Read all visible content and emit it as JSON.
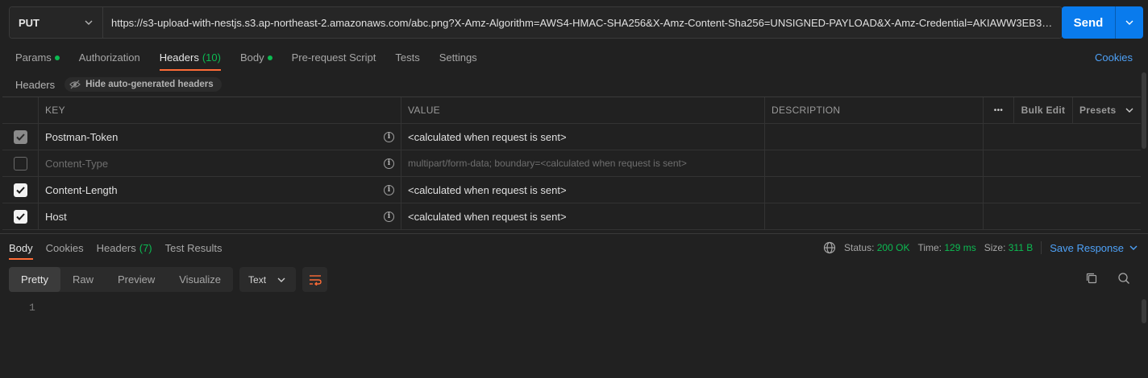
{
  "request": {
    "method": "PUT",
    "url": "https://s3-upload-with-nestjs.s3.ap-northeast-2.amazonaws.com/abc.png?X-Amz-Algorithm=AWS4-HMAC-SHA256&X-Amz-Content-Sha256=UNSIGNED-PAYLOAD&X-Amz-Credential=AKIAWW3EB3Y6...",
    "send_label": "Send"
  },
  "req_tabs": {
    "params": "Params",
    "authorization": "Authorization",
    "headers": "Headers",
    "headers_count": "(10)",
    "body": "Body",
    "prerequest": "Pre-request Script",
    "tests": "Tests",
    "settings": "Settings",
    "cookies": "Cookies"
  },
  "headers_section": {
    "title": "Headers",
    "hide_auto": "Hide auto-generated headers"
  },
  "table": {
    "columns": {
      "key": "KEY",
      "value": "VALUE",
      "description": "DESCRIPTION",
      "more": "•••",
      "bulk_edit": "Bulk Edit",
      "presets": "Presets"
    },
    "rows": [
      {
        "checked": "dim",
        "key": "Postman-Token",
        "value": "<calculated when request is sent>",
        "muted": false
      },
      {
        "checked": "off",
        "key": "Content-Type",
        "value": "multipart/form-data; boundary=<calculated when request is sent>",
        "muted": true
      },
      {
        "checked": "on",
        "key": "Content-Length",
        "value": "<calculated when request is sent>",
        "muted": false
      },
      {
        "checked": "on",
        "key": "Host",
        "value": "<calculated when request is sent>",
        "muted": false
      }
    ]
  },
  "response": {
    "tabs": {
      "body": "Body",
      "cookies": "Cookies",
      "headers": "Headers",
      "headers_count": "(7)",
      "test_results": "Test Results"
    },
    "status_label": "Status:",
    "status_value": "200 OK",
    "time_label": "Time:",
    "time_value": "129 ms",
    "size_label": "Size:",
    "size_value": "311 B",
    "save_response": "Save Response",
    "formats": [
      "Pretty",
      "Raw",
      "Preview",
      "Visualize"
    ],
    "text_type": "Text",
    "line_number": "1"
  },
  "colors": {
    "accent": "#ff6c37",
    "send": "#097bed",
    "green": "#0cbb52",
    "link": "#4ea1f7"
  }
}
